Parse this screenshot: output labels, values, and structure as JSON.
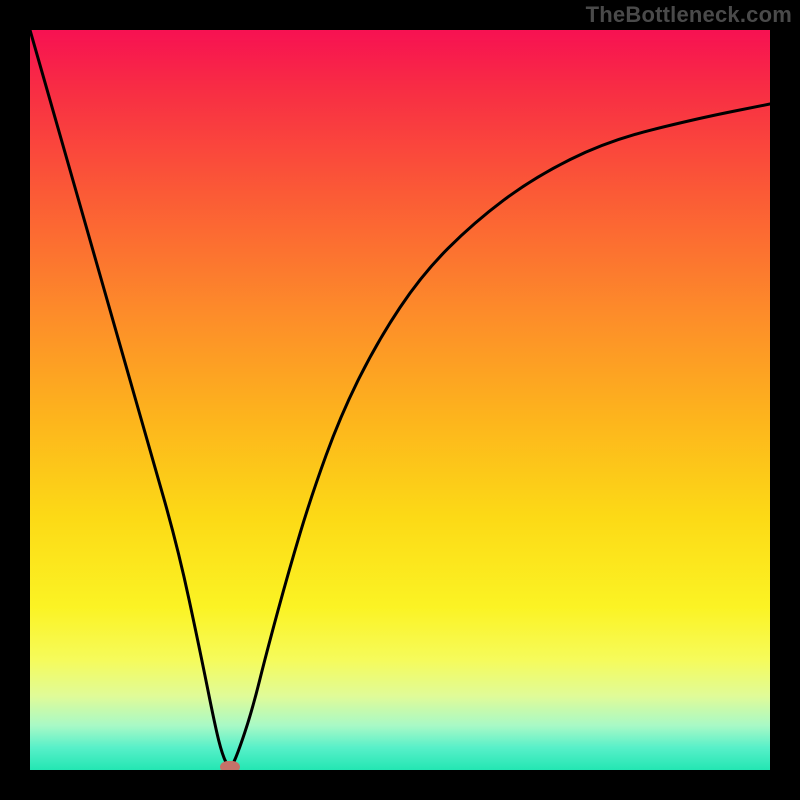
{
  "watermark": "TheBottleneck.com",
  "chart_data": {
    "type": "line",
    "title": "",
    "xlabel": "",
    "ylabel": "",
    "xlim": [
      0,
      100
    ],
    "ylim": [
      0,
      100
    ],
    "grid": false,
    "series": [
      {
        "name": "curve",
        "x": [
          0,
          4,
          8,
          12,
          16,
          20,
          23,
          25,
          26,
          27,
          28,
          30,
          32,
          35,
          38,
          42,
          47,
          53,
          60,
          68,
          78,
          90,
          100
        ],
        "y": [
          100,
          86,
          72,
          58,
          44,
          30,
          16,
          6,
          2,
          0,
          2,
          8,
          16,
          27,
          37,
          48,
          58,
          67,
          74,
          80,
          85,
          88,
          90
        ]
      }
    ],
    "marker": {
      "x": 27,
      "y": 0,
      "color": "#c57269"
    },
    "background_gradient_stops": [
      {
        "pos": 0,
        "color": "#f71152"
      },
      {
        "pos": 8,
        "color": "#f82d44"
      },
      {
        "pos": 22,
        "color": "#fb5a36"
      },
      {
        "pos": 38,
        "color": "#fd8b2a"
      },
      {
        "pos": 52,
        "color": "#fdb31d"
      },
      {
        "pos": 66,
        "color": "#fcda16"
      },
      {
        "pos": 78,
        "color": "#fbf324"
      },
      {
        "pos": 85,
        "color": "#f6fb5a"
      },
      {
        "pos": 90,
        "color": "#e0fb98"
      },
      {
        "pos": 94,
        "color": "#a8f9c6"
      },
      {
        "pos": 97,
        "color": "#57f0c9"
      },
      {
        "pos": 100,
        "color": "#23e6b3"
      }
    ]
  }
}
